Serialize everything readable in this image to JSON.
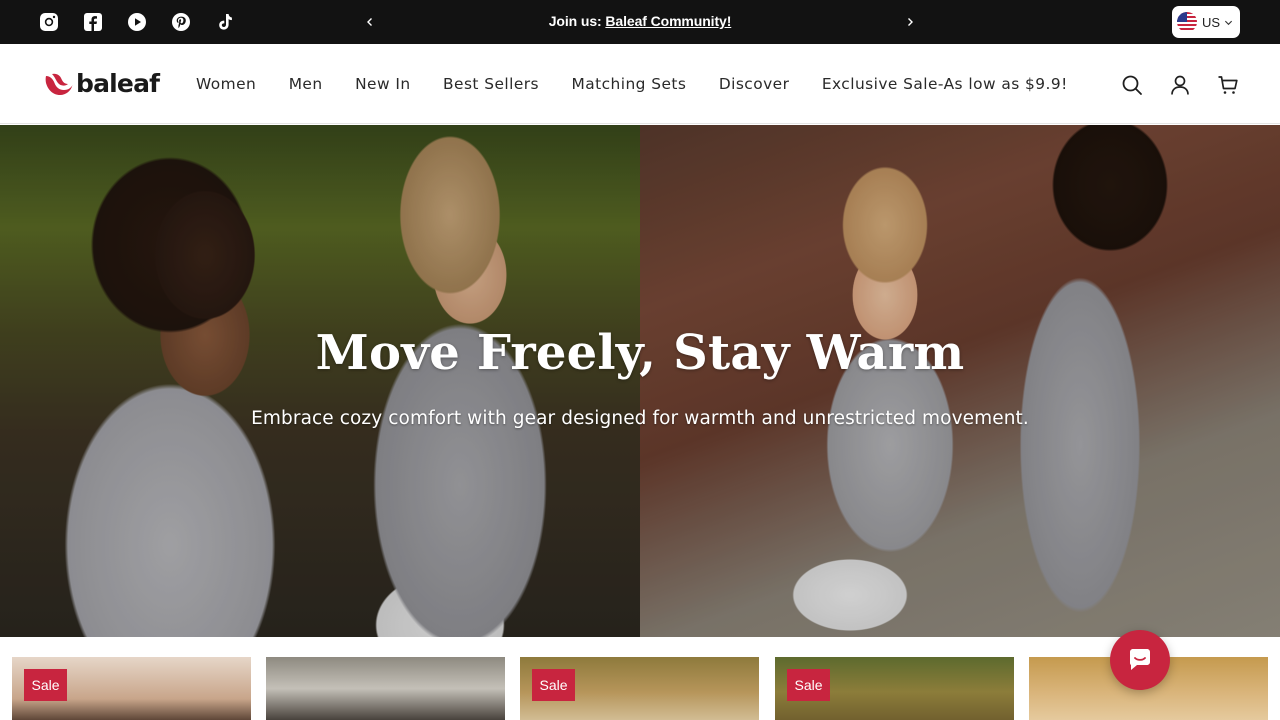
{
  "announcement": {
    "prefix": "Join us:",
    "link_text": "Baleaf Community!",
    "social_icons": [
      "instagram-icon",
      "facebook-icon",
      "youtube-icon",
      "pinterest-icon",
      "tiktok-icon"
    ]
  },
  "country": {
    "code": "US",
    "flag": "us-flag-icon"
  },
  "header": {
    "logo_text": "baleaf",
    "nav": [
      "Women",
      "Men",
      "New In",
      "Best Sellers",
      "Matching Sets",
      "Discover",
      "Exclusive Sale-As low as $9.9!"
    ],
    "icons": [
      "search-icon",
      "account-icon",
      "cart-icon"
    ]
  },
  "hero": {
    "title": "Move Freely, Stay Warm",
    "subtitle": "Embrace cozy comfort with gear designed for warmth and unrestricted movement."
  },
  "products": {
    "badge": "Sale",
    "cards": [
      {
        "badge": "Sale"
      },
      {
        "badge": ""
      },
      {
        "badge": "Sale"
      },
      {
        "badge": "Sale"
      },
      {
        "badge": ""
      }
    ]
  },
  "colors": {
    "accent": "#c8253f",
    "topbar": "#121212",
    "text": "#1f1f1f"
  }
}
